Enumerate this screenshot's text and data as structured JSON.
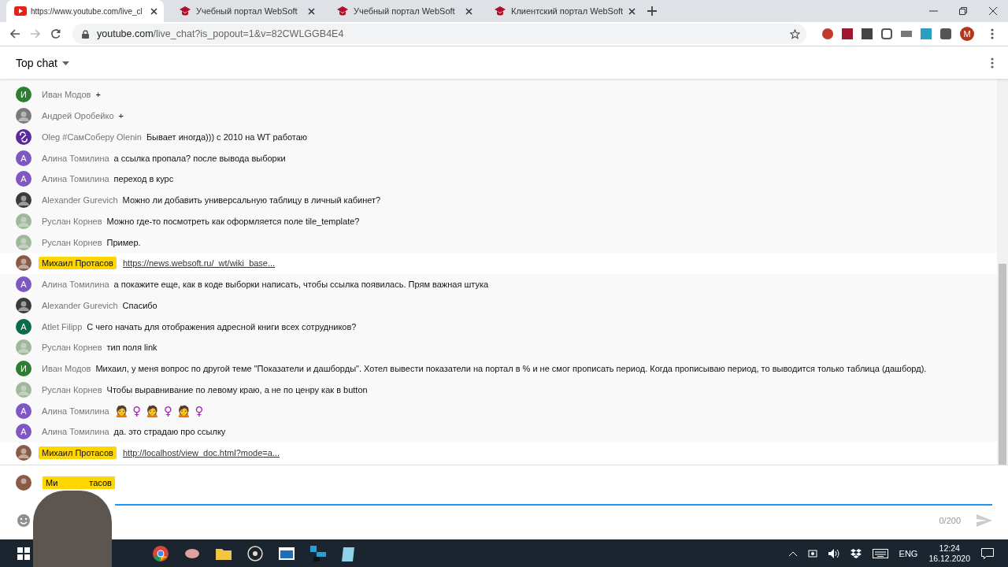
{
  "browser": {
    "tabs": [
      {
        "title": "https://www.youtube.com/live_cl",
        "kind": "youtube",
        "selected": true
      },
      {
        "title": "Учебный портал WebSoft",
        "kind": "websoft",
        "selected": false
      },
      {
        "title": "Учебный портал WebSoft",
        "kind": "websoft",
        "selected": false
      },
      {
        "title": "Клиентский портал WebSoft",
        "kind": "websoft",
        "selected": false
      }
    ],
    "address": {
      "host": "youtube.com",
      "path": "/live_chat?is_popout=1&v=82CWLGGB4E4"
    },
    "profile_initial": "M"
  },
  "chat": {
    "header": "Top chat",
    "messages": [
      {
        "author": "Иван Модов",
        "text": "+",
        "kind": "normal",
        "avatar": {
          "kind": "letter",
          "letter": "И",
          "color": "#2e7d32"
        }
      },
      {
        "author": "Андрей Оробейко",
        "text": "+",
        "kind": "normal",
        "avatar": {
          "kind": "photo",
          "color": "#7a7a7a"
        }
      },
      {
        "author": "Oleg #СамСоберу Olenin",
        "text": "Бывает иногда))) с 2010 на WT работаю",
        "kind": "normal",
        "avatar": {
          "kind": "logo",
          "color": "#5b2a9e"
        }
      },
      {
        "author": "Алина Томилина",
        "text": "а ссылка пропала? после вывода выборки",
        "kind": "normal",
        "avatar": {
          "kind": "letter",
          "letter": "А",
          "color": "#7e57c2"
        }
      },
      {
        "author": "Алина Томилина",
        "text": "переход в курс",
        "kind": "normal",
        "avatar": {
          "kind": "letter",
          "letter": "А",
          "color": "#7e57c2"
        }
      },
      {
        "author": "Alexander Gurevich",
        "text": "Можно ли добавить универсальную таблицу в личный кабинет?",
        "kind": "normal",
        "avatar": {
          "kind": "photo",
          "color": "#3a3a3a"
        }
      },
      {
        "author": "Руслан Корнев",
        "text": "Можно где-то посмотреть как оформляется поле tile_template?",
        "kind": "normal",
        "avatar": {
          "kind": "photo",
          "color": "#9fb89a"
        }
      },
      {
        "author": "Руслан Корнев",
        "text": "Пример.",
        "kind": "normal",
        "avatar": {
          "kind": "photo",
          "color": "#9fb89a"
        }
      },
      {
        "author": "Михаил Протасов",
        "text": "https://news.websoft.ru/_wt/wiki_base...",
        "kind": "owner",
        "avatar": {
          "kind": "photo",
          "color": "#8a5a44"
        }
      },
      {
        "author": "Алина Томилина",
        "text": "а покажите еще, как в коде выборки написать, чтобы ссылка появилась. Прям важная штука",
        "kind": "normal",
        "avatar": {
          "kind": "letter",
          "letter": "А",
          "color": "#7e57c2"
        }
      },
      {
        "author": "Alexander Gurevich",
        "text": "Спасибо",
        "kind": "normal",
        "avatar": {
          "kind": "photo",
          "color": "#3a3a3a"
        }
      },
      {
        "author": "Atlet Filipp",
        "text": "С чего начать для отображения адресной книги всех сотрудников?",
        "kind": "normal",
        "avatar": {
          "kind": "letter",
          "letter": "A",
          "color": "#0b6b4f"
        }
      },
      {
        "author": "Руслан Корнев",
        "text": "тип поля link",
        "kind": "normal",
        "avatar": {
          "kind": "photo",
          "color": "#9fb89a"
        }
      },
      {
        "author": "Иван Модов",
        "text": "Михаил, у меня вопрос по другой теме \"Показатели и дашборды\". Хотел вывести показатели на портал в % и не смог прописать период. Когда прописываю период, то выводится только таблица (дашборд).",
        "kind": "normal",
        "avatar": {
          "kind": "letter",
          "letter": "И",
          "color": "#2e7d32"
        }
      },
      {
        "author": "Руслан Корнев",
        "text": "Чтобы выравнивание по левому краю, а не по ценру как в button",
        "kind": "normal",
        "avatar": {
          "kind": "photo",
          "color": "#9fb89a"
        }
      },
      {
        "author": "Алина Томилина",
        "text": "🙍 ♀ 🙍 ♀ 🙍 ♀",
        "kind": "emoji",
        "avatar": {
          "kind": "letter",
          "letter": "А",
          "color": "#7e57c2"
        }
      },
      {
        "author": "Алина Томилина",
        "text": "да. это страдаю про ссылку",
        "kind": "normal",
        "avatar": {
          "kind": "letter",
          "letter": "А",
          "color": "#7e57c2"
        }
      },
      {
        "author": "Михаил Протасов",
        "text": "http://localhost/view_doc.html?mode=a...",
        "kind": "owner",
        "avatar": {
          "kind": "photo",
          "color": "#8a5a44"
        }
      }
    ],
    "input": {
      "author_fragments": [
        "Ми",
        "тасов"
      ],
      "counter": "0/200"
    }
  },
  "taskbar": {
    "language": "ENG",
    "time": "12:24",
    "date": "16.12.2020"
  }
}
